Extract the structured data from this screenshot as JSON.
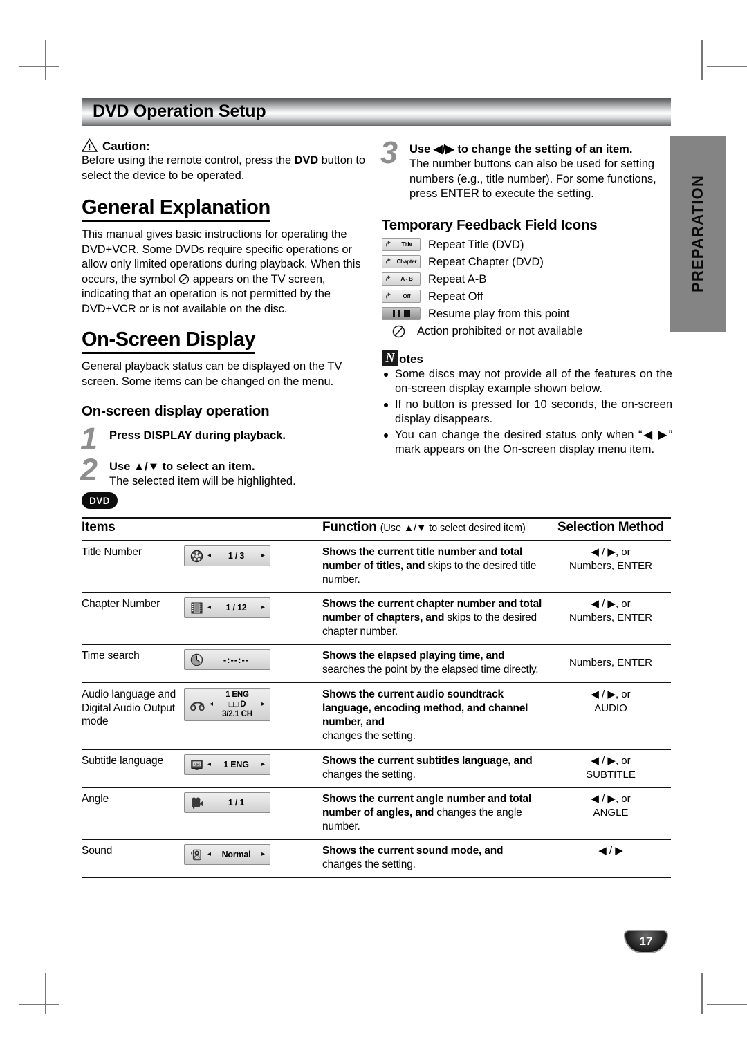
{
  "header": {
    "title": "DVD Operation Setup"
  },
  "side_tab": {
    "label": "PREPARATION"
  },
  "left_column": {
    "caution": {
      "label": "Caution:",
      "icon": "warning-triangle-icon",
      "text_1": "Before using the remote control, press the ",
      "text_bold": "DVD",
      "text_2": " button to select the device to be operated."
    },
    "general_explanation": {
      "heading": "General Explanation",
      "paragraph_1": "This manual gives basic instructions for operating the DVD+VCR. Some DVDs require specific operations or allow only limited operations during playback. When this occurs, the symbol ",
      "paragraph_2": " appears on the TV screen, indicating that an operation is not permitted by the DVD+VCR or is not available on the disc."
    },
    "on_screen_display": {
      "heading": "On-Screen Display",
      "paragraph": "General playback status can be displayed on the TV screen. Some items can be changed on the menu."
    },
    "osd_operation": {
      "heading": "On-screen display operation",
      "steps": [
        {
          "number": "1",
          "bold": "Press DISPLAY during playback.",
          "normal": ""
        },
        {
          "number": "2",
          "bold": "Use ▲/▼ to select an item.",
          "normal": "The selected item will be highlighted."
        }
      ]
    }
  },
  "right_column": {
    "step3": {
      "number": "3",
      "bold": "Use ◀/▶ to change the setting of an item.",
      "normal": "The number buttons can also be used for setting numbers (e.g., title number). For some functions, press ENTER to execute the setting."
    },
    "feedback_icons": {
      "heading": "Temporary Feedback Field Icons",
      "items": [
        {
          "chip_text": "Title",
          "icon": "repeat-arrow-icon",
          "label": "Repeat Title (DVD)"
        },
        {
          "chip_text": "Chapter",
          "icon": "repeat-arrow-icon",
          "label": "Repeat Chapter (DVD)"
        },
        {
          "chip_text": "A - B",
          "icon": "repeat-arrow-icon",
          "label": "Repeat A-B"
        },
        {
          "chip_text": "Off",
          "icon": "repeat-arrow-icon",
          "label": "Repeat Off"
        },
        {
          "chip_text": "",
          "icon": "pause-stop-icon",
          "label": "Resume play from this point"
        },
        {
          "chip_text": "",
          "icon": "prohibited-icon",
          "label": "Action prohibited or not available"
        }
      ]
    },
    "notes": {
      "badge_letter": "N",
      "heading_rest": "otes",
      "items": [
        "Some discs may not provide all of the features on the on-screen display example shown below.",
        "If no button is pressed for 10 seconds, the on-screen display disappears.",
        "You can change the desired status only when “◀ ▶” mark appears on the On-screen display menu item."
      ]
    }
  },
  "table": {
    "badge": "DVD",
    "headers": {
      "items": "Items",
      "function": "Function",
      "function_sub": "(Use ▲/▼ to select desired item)",
      "selection": "Selection Method"
    },
    "rows": [
      {
        "item": "Title Number",
        "osd": {
          "icon": "film-reel-icon",
          "value": "1 / 3",
          "left_arrow": "◂",
          "right_arrow": "▸"
        },
        "fn_bold": "Shows the current title number and total number of titles, and",
        "fn_normal": " skips to the desired title number.",
        "selection": "◀ / ▶, or\nNumbers, ENTER"
      },
      {
        "item": "Chapter Number",
        "osd": {
          "icon": "film-strip-icon",
          "value": "1 / 12",
          "left_arrow": "◂",
          "right_arrow": "▸"
        },
        "fn_bold": "Shows the current chapter number and total number of chapters, and",
        "fn_normal": " skips to the desired chapter number.",
        "selection": "◀ / ▶, or\nNumbers, ENTER"
      },
      {
        "item": "Time search",
        "osd": {
          "icon": "clock-icon",
          "value": "-:--:--",
          "left_arrow": "",
          "right_arrow": ""
        },
        "fn_bold": "Shows the elapsed playing time, and",
        "fn_normal": "searches the point by the elapsed time directly.",
        "selection": "Numbers, ENTER"
      },
      {
        "item": "Audio language and Digital Audio Output mode",
        "osd": {
          "icon": "headphones-icon",
          "value_l1": "1 ENG",
          "value_l2": "□□ D",
          "value_l3": "3/2.1 CH",
          "left_arrow": "◂",
          "right_arrow": "▸"
        },
        "fn_bold": "Shows the current audio soundtrack language, encoding method, and channel number, and",
        "fn_normal": "changes the setting.",
        "selection": "◀ / ▶, or\nAUDIO"
      },
      {
        "item": "Subtitle language",
        "osd": {
          "icon": "subtitle-icon",
          "value": "1 ENG",
          "left_arrow": "◂",
          "right_arrow": "▸"
        },
        "fn_bold": "Shows the current subtitles language, and",
        "fn_normal": "changes the setting.",
        "selection": "◀ / ▶, or\nSUBTITLE"
      },
      {
        "item": "Angle",
        "osd": {
          "icon": "camera-icon",
          "value": "1 / 1",
          "left_arrow": "",
          "right_arrow": ""
        },
        "fn_bold": "Shows the current angle number and total number of angles, and",
        "fn_normal": " changes the angle number.",
        "selection": "◀ / ▶, or\nANGLE"
      },
      {
        "item": "Sound",
        "osd": {
          "icon": "speaker-icon",
          "value": "Normal",
          "left_arrow": "◂",
          "right_arrow": "▸"
        },
        "fn_bold": "Shows the current sound mode, and",
        "fn_normal": "changes the setting.",
        "selection": "◀ / ▶"
      }
    ]
  },
  "page_number": "17"
}
